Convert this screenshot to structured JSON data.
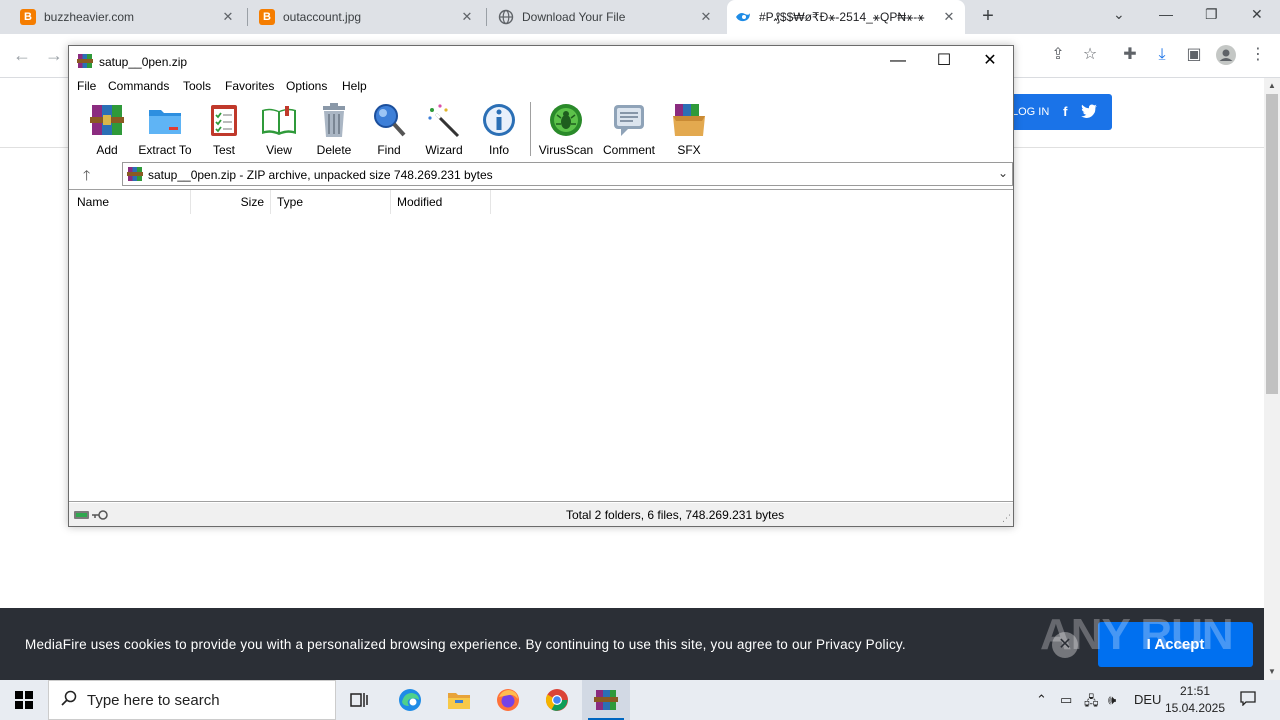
{
  "browser": {
    "tabs": [
      {
        "title": "buzzheavier.com",
        "favicon": "blogger-icon"
      },
      {
        "title": "outaccount.jpg",
        "favicon": "blogger-icon"
      },
      {
        "title": "Download Your File",
        "favicon": "globe-icon"
      },
      {
        "title": "#P₰$$₩ø₹Ð⚹-2514_⚹QP₦⚹-⚹",
        "favicon": "mediafire-icon"
      }
    ],
    "page": {
      "login_label": "LOG IN",
      "cookie_message": "MediaFire uses cookies to provide you with a personalized browsing experience. By continuing to use this site, you agree to our Privacy Policy.",
      "accept_label": "I Accept",
      "watermark": "ANY RUN"
    }
  },
  "winrar": {
    "title": "satup__0pen.zip",
    "menu": [
      "File",
      "Commands",
      "Tools",
      "Favorites",
      "Options",
      "Help"
    ],
    "toolbar": [
      "Add",
      "Extract To",
      "Test",
      "View",
      "Delete",
      "Find",
      "Wizard",
      "Info",
      "VirusScan",
      "Comment",
      "SFX"
    ],
    "path_text": "satup__0pen.zip - ZIP archive, unpacked size 748.269.231 bytes",
    "columns": [
      "Name",
      "Size",
      "Type",
      "Modified"
    ],
    "status_text": "Total 2 folders, 6 files, 748.269.231 bytes"
  },
  "taskbar": {
    "search_placeholder": "Type here to search",
    "language": "DEU",
    "time": "21:51",
    "date": "15.04.2025"
  },
  "colors": {
    "accent": "#1a73e8",
    "cookie_bg": "#2b2f36",
    "accept_btn": "#0070f0",
    "tabstrip": "#dee1e6"
  }
}
